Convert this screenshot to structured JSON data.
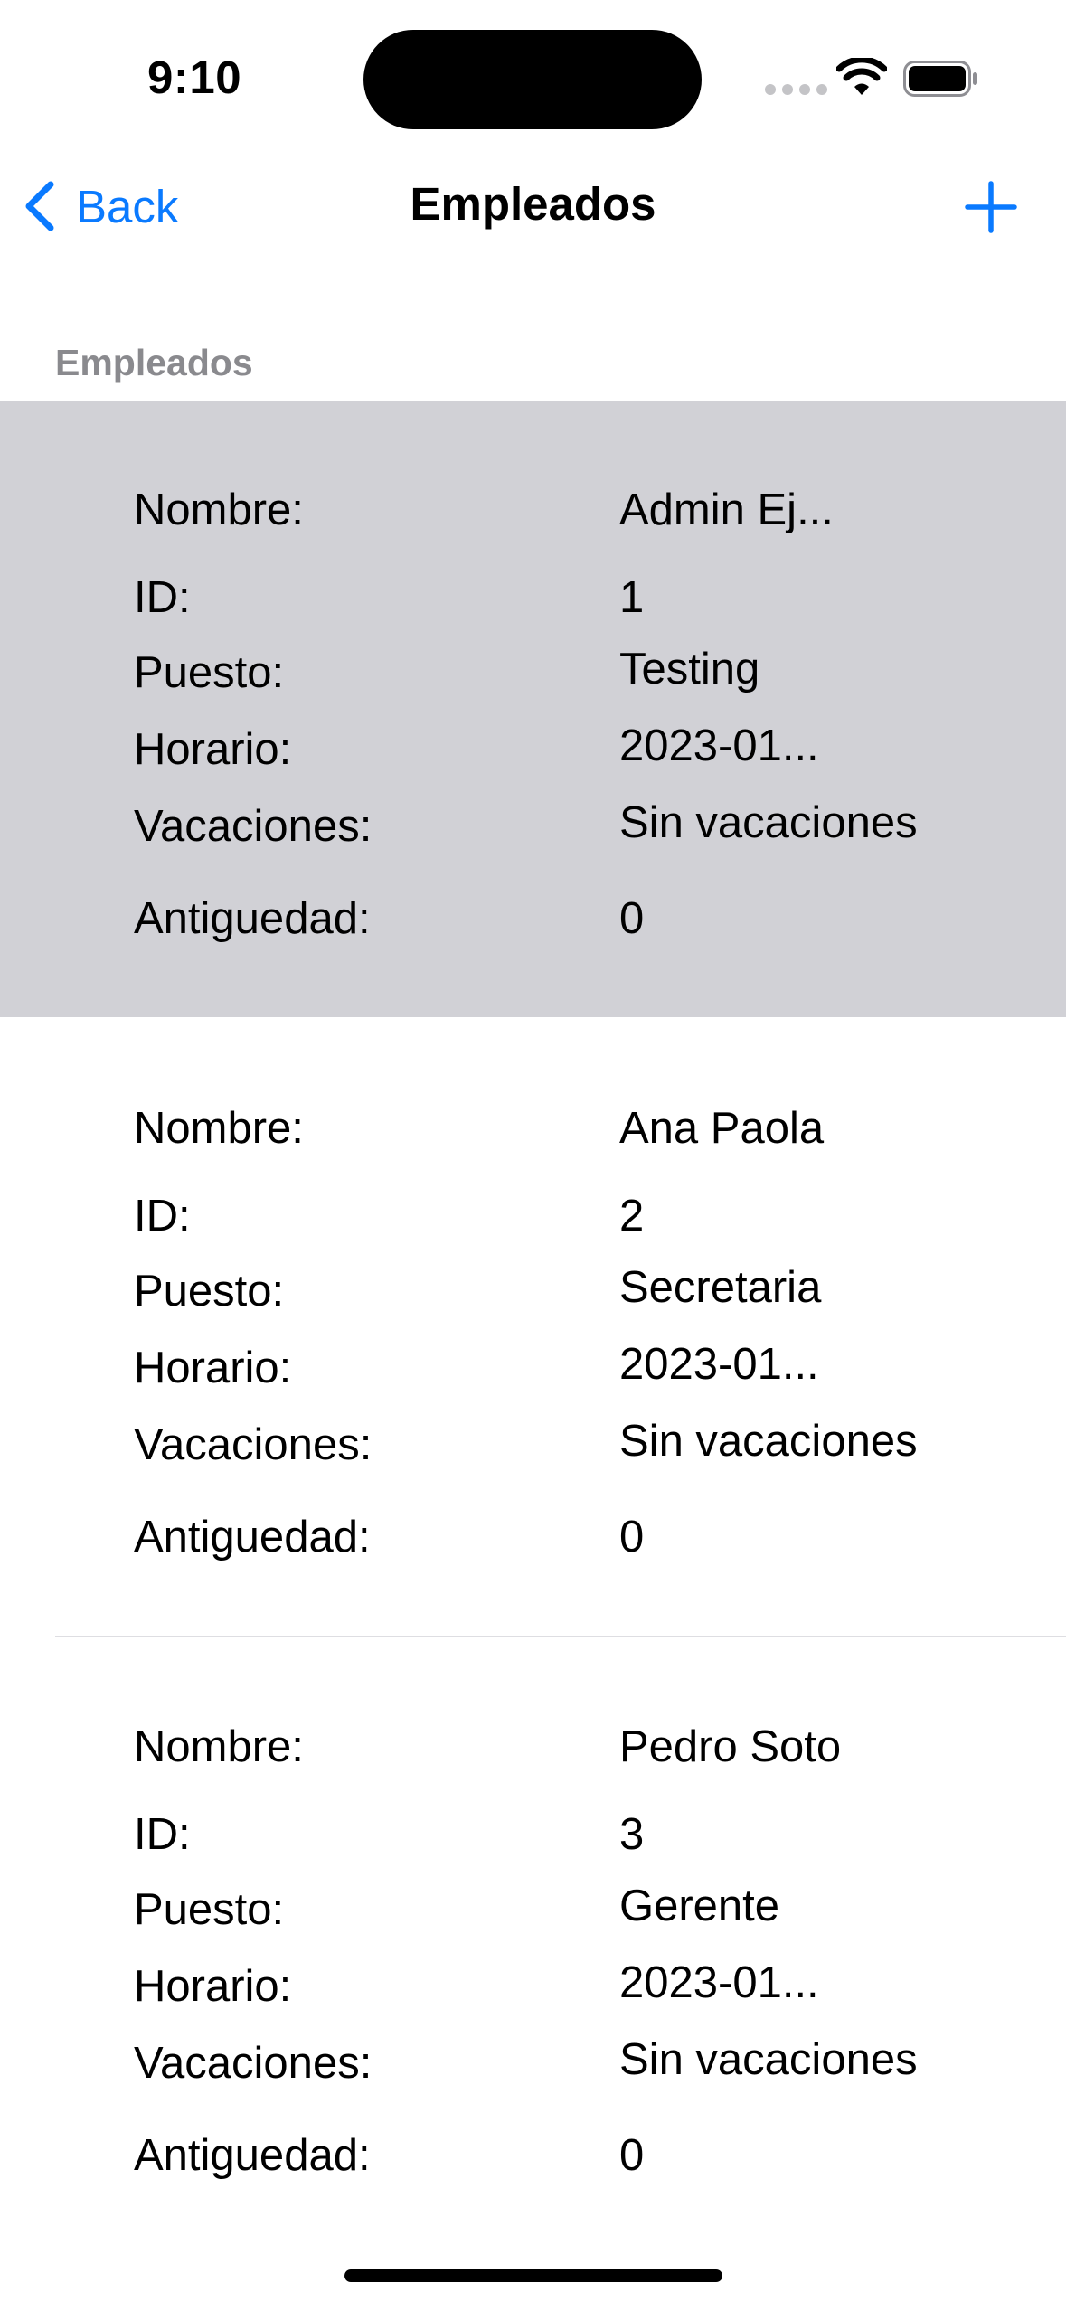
{
  "status_bar": {
    "time": "9:10"
  },
  "nav": {
    "back_label": "Back",
    "title": "Empleados",
    "add_icon": "plus-icon",
    "accent_color": "#0a7aff"
  },
  "section": {
    "header": "Empleados"
  },
  "labels": {
    "nombre": "Nombre:",
    "id": "ID:",
    "puesto": "Puesto:",
    "horario": "Horario:",
    "vacaciones": "Vacaciones:",
    "antiguedad": "Antiguedad:"
  },
  "employees": [
    {
      "nombre": "Admin Ej...",
      "id": "1",
      "puesto": "Testing",
      "horario": "2023-01...",
      "vacaciones": "Sin vacaciones",
      "antiguedad": "0",
      "selected": true
    },
    {
      "nombre": "Ana Paola",
      "id": "2",
      "puesto": "Secretaria",
      "horario": "2023-01...",
      "vacaciones": "Sin vacaciones",
      "antiguedad": "0",
      "selected": false
    },
    {
      "nombre": "Pedro Soto",
      "id": "3",
      "puesto": "Gerente",
      "horario": "2023-01...",
      "vacaciones": "Sin vacaciones",
      "antiguedad": "0",
      "selected": false
    }
  ]
}
